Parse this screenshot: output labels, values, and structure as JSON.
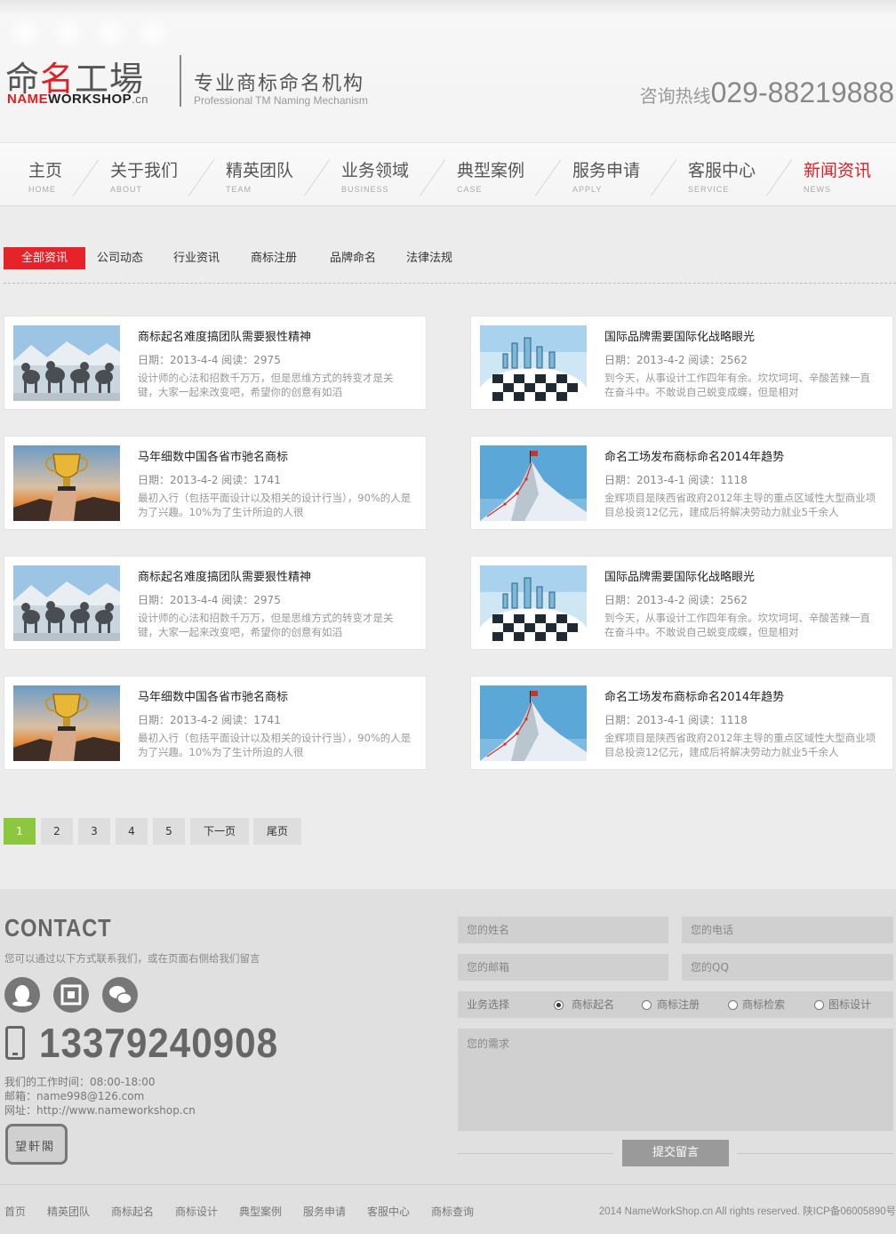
{
  "header": {
    "logo_cn_1": "命",
    "logo_cn_2": "名",
    "logo_cn_3": "工場",
    "logo_en_1": "NAME",
    "logo_en_2": "WORKSHOP",
    "logo_en_3": ".cn",
    "slogan": "专业商标命名机构",
    "slogan_en": "Professional TM Naming Mechanism",
    "hotline_label": "咨询热线",
    "hotline_number": "029-88219888"
  },
  "nav": [
    {
      "cn": "主页",
      "en": "HOME"
    },
    {
      "cn": "关于我们",
      "en": "ABOUT"
    },
    {
      "cn": "精英团队",
      "en": "TEAM"
    },
    {
      "cn": "业务领域",
      "en": "BUSINESS"
    },
    {
      "cn": "典型案例",
      "en": "CASE"
    },
    {
      "cn": "服务申请",
      "en": "APPLY"
    },
    {
      "cn": "客服中心",
      "en": "SERVICE"
    },
    {
      "cn": "新闻资讯",
      "en": "NEWS"
    }
  ],
  "tabs": [
    "全部资讯",
    "公司动态",
    "行业资讯",
    "商标注册",
    "品牌命名",
    "法律法规"
  ],
  "news": [
    {
      "title": "商标起名难度搞团队需要狠性精神",
      "meta": "日期：2013-4-4  阅读：2975",
      "desc": "设计师的心法和招数千万万，但是思维方式的转变才是关键，大家一起来改变吧，希望你的创意有如滔"
    },
    {
      "title": "国际品牌需要国际化战略眼光",
      "meta": "日期：2013-4-2  阅读：2562",
      "desc": "到今天，从事设计工作四年有余。坎坎坷坷、辛酸苦辣一直在奋斗中。不敢说自己蜕变成蝶，但是相对"
    },
    {
      "title": "马年细数中国各省市驰名商标",
      "meta": "日期：2013-4-2  阅读：1741",
      "desc": "最初入行（包括平面设计以及相关的设计行当），90%的人是为了兴趣。10%为了生计所迫的人很"
    },
    {
      "title": "命名工场发布商标命名2014年趋势",
      "meta": "日期：2013-4-1  阅读：1118",
      "desc": "金辉项目是陕西省政府2012年主导的重点区域性大型商业项目总投资12亿元，建成后将解决劳动力就业5千余人"
    },
    {
      "title": "商标起名难度搞团队需要狠性精神",
      "meta": "日期：2013-4-4  阅读：2975",
      "desc": "设计师的心法和招数千万万，但是思维方式的转变才是关键，大家一起来改变吧，希望你的创意有如滔"
    },
    {
      "title": "国际品牌需要国际化战略眼光",
      "meta": "日期：2013-4-2  阅读：2562",
      "desc": "到今天，从事设计工作四年有余。坎坎坷坷、辛酸苦辣一直在奋斗中。不敢说自己蜕变成蝶，但是相对"
    },
    {
      "title": "马年细数中国各省市驰名商标",
      "meta": "日期：2013-4-2  阅读：1741",
      "desc": "最初入行（包括平面设计以及相关的设计行当），90%的人是为了兴趣。10%为了生计所迫的人很"
    },
    {
      "title": "命名工场发布商标命名2014年趋势",
      "meta": "日期：2013-4-1  阅读：1118",
      "desc": "金辉项目是陕西省政府2012年主导的重点区域性大型商业项目总投资12亿元，建成后将解决劳动力就业5千余人"
    }
  ],
  "pagination": [
    "1",
    "2",
    "3",
    "4",
    "5",
    "下一页",
    "尾页"
  ],
  "contact": {
    "title": "CONTACT",
    "subtitle": "您可以通过以下方式联系我们，或在页面右侧给我们留言",
    "phone": "13379240908",
    "hours": "我们的工作时间：08:00-18:00",
    "email": "邮箱：name998@126.com",
    "website": "网址：http://www.nameworkshop.cn",
    "stamp": "望軒閣"
  },
  "form": {
    "name_placeholder": "您的姓名",
    "tel_placeholder": "您的电话",
    "email_placeholder": "您的邮箱",
    "qq_placeholder": "您的QQ",
    "service_label": "业务选择",
    "options": [
      "商标起名",
      "商标注册",
      "商标检索",
      "图标设计"
    ],
    "need_placeholder": "您的需求",
    "submit": "提交留言"
  },
  "footer": {
    "links": [
      "首页",
      "精英团队",
      "商标起名",
      "商标设计",
      "典型案例",
      "服务申请",
      "客服中心",
      "商标查询"
    ],
    "copyright": "2014 NameWorkShop.cn All rights reserved. 陕ICP备06005890号"
  },
  "colors": {
    "accent": "#e52328",
    "page_active": "#8dc63f"
  },
  "icons": [
    "qq-icon",
    "qrcode-icon",
    "wechat-icon",
    "mobile-phone-icon"
  ]
}
